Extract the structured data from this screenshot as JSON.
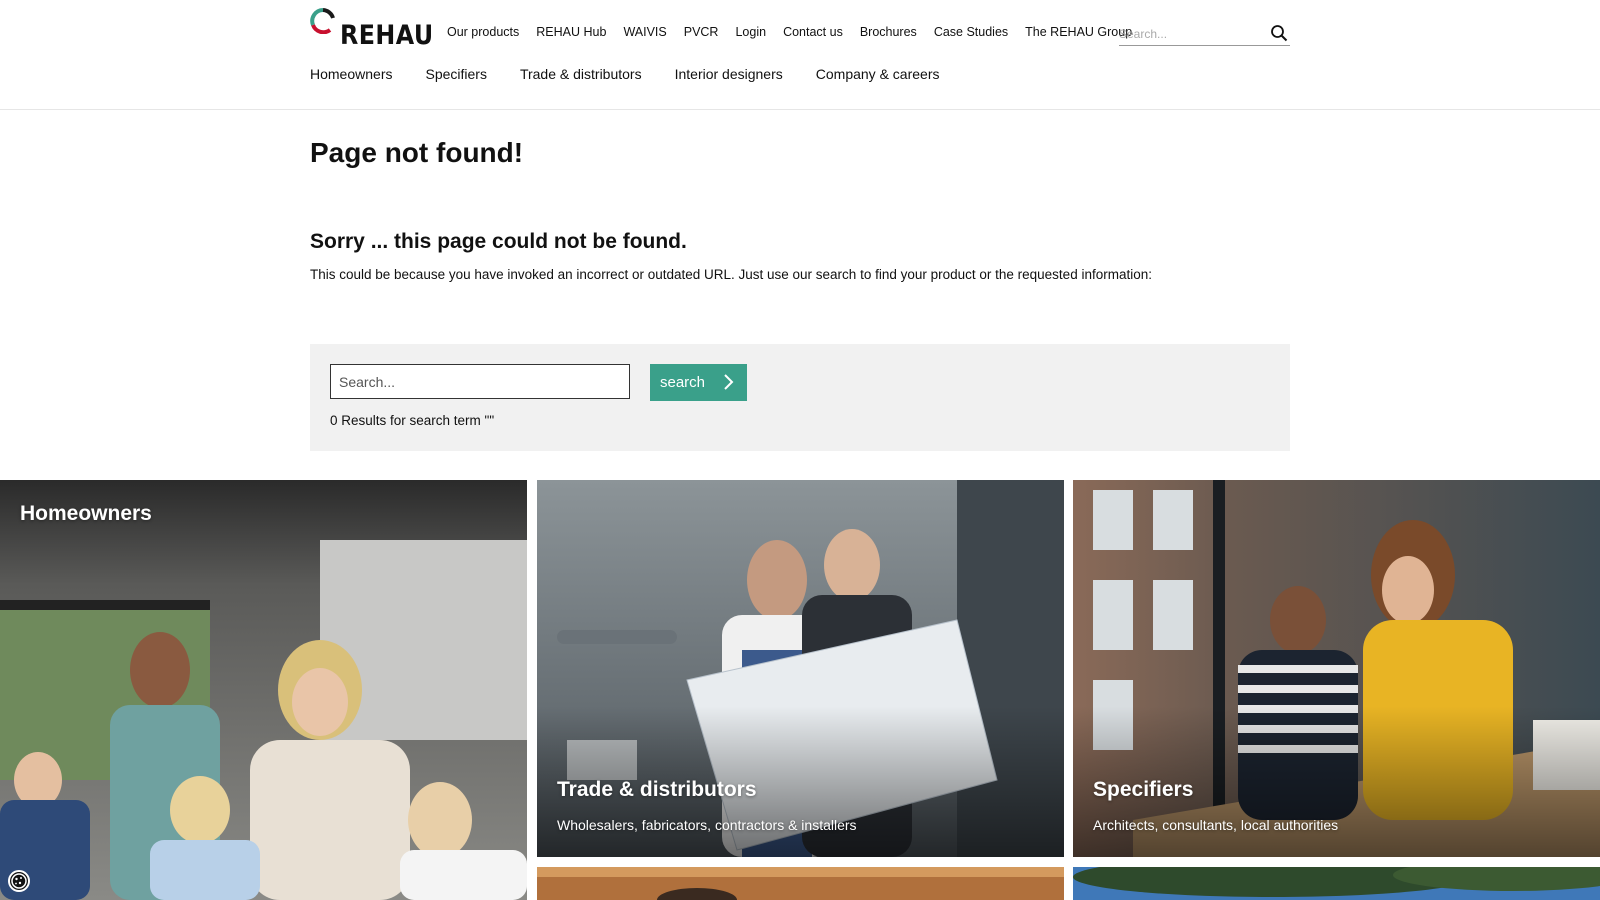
{
  "brand": {
    "name": "REHAU",
    "accent": "#3aa08a"
  },
  "topnav": [
    "Our products",
    "REHAU Hub",
    "WAIVIS",
    "PVCR",
    "Login",
    "Contact us",
    "Brochures",
    "Case Studies",
    "The REHAU Group"
  ],
  "header_search": {
    "placeholder": "Search...",
    "icon": "search-icon"
  },
  "mainnav": [
    "Homeowners",
    "Specifiers",
    "Trade & distributors",
    "Interior designers",
    "Company & careers"
  ],
  "main": {
    "title": "Page not found!",
    "sorry": "Sorry ... this page could not be found.",
    "explain": "This could be because you have invoked an incorrect or outdated URL. Just use our search to find your product or the requested information:",
    "search": {
      "placeholder": "Search...",
      "button_label": "search",
      "results_text": "0 Results for search term \"\""
    }
  },
  "tiles": [
    {
      "title": "Homeowners",
      "subtitle": ""
    },
    {
      "title": "Trade & distributors",
      "subtitle": "Wholesalers, fabricators, contractors & installers"
    },
    {
      "title": "Specifiers",
      "subtitle": "Architects, consultants, local authorities"
    }
  ],
  "cookie_icon": "cookie-icon"
}
